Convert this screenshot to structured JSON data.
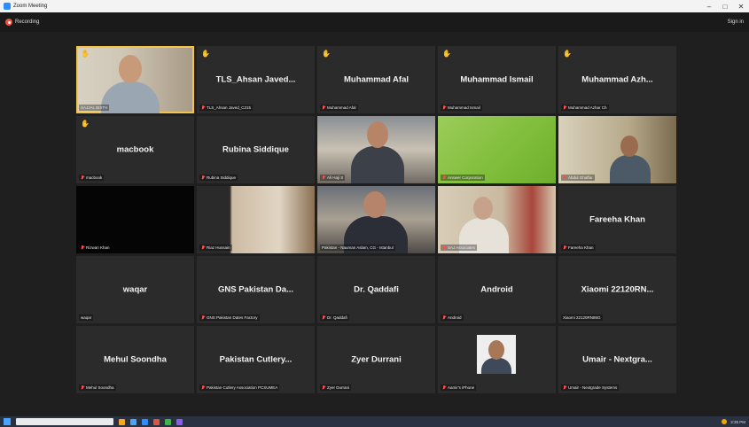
{
  "window": {
    "title": "Zoom Meeting",
    "minimize": "–",
    "maximize": "□",
    "close": "✕"
  },
  "topbar": {
    "recording_label": "Recording",
    "signin_label": "Sign in"
  },
  "tiles": [
    {
      "name": "",
      "label": "SAJJAL BISTH",
      "video": "cam-man",
      "highlight": true,
      "hand": true,
      "mic_off": false
    },
    {
      "name": "TLS_Ahsan Javed...",
      "label": "TLS_Ahsan Javed_C215",
      "hand": true,
      "mic_off": true
    },
    {
      "name": "Muhammad Afal",
      "label": "Muhammad Afal",
      "hand": true,
      "mic_off": true
    },
    {
      "name": "Muhammad Ismail",
      "label": "Muhammad Ismail",
      "hand": true,
      "mic_off": true
    },
    {
      "name": "Muhammad Azh...",
      "label": "Muhammad Azhar Ch",
      "hand": true,
      "mic_off": true
    },
    {
      "name": "macbook",
      "label": "macbook",
      "hand": true,
      "mic_off": true
    },
    {
      "name": "Rubina Siddique",
      "label": "Rubina Siddique",
      "hand": false,
      "mic_off": true
    },
    {
      "name": "",
      "label": "Ali Haji S",
      "video": "cam-office",
      "mic_off": true
    },
    {
      "name": "",
      "label": "Answer Corporation",
      "video": "cam-green",
      "mic_off": true
    },
    {
      "name": "",
      "label": "Abdul Ghaffar",
      "video": "cam-room",
      "mic_off": true
    },
    {
      "name": "",
      "label": "Rizwan Khan",
      "video": "cam-black",
      "mic_off": true
    },
    {
      "name": "",
      "label": "Riaz Hussain",
      "video": "cam-wall",
      "mic_off": true
    },
    {
      "name": "",
      "label": "Pakistan - Nauman Aslam, CG - Istanbul",
      "video": "cam-suit",
      "mic_off": false
    },
    {
      "name": "",
      "label": "SAJ Associates",
      "video": "cam-elder",
      "mic_off": true
    },
    {
      "name": "Fareeha Khan",
      "label": "Fareeha Khan",
      "mic_off": true
    },
    {
      "name": "waqar",
      "label": "waqar",
      "mic_off": false
    },
    {
      "name": "GNS Pakistan Da...",
      "label": "GNS Pakistan Dates Factory",
      "mic_off": true
    },
    {
      "name": "Dr. Qaddafi",
      "label": "Dr. Qaddafi",
      "mic_off": true
    },
    {
      "name": "Android",
      "label": "Android",
      "mic_off": true
    },
    {
      "name": "Xiaomi 22120RN...",
      "label": "Xiaomi 22120RN86G",
      "mic_off": false
    },
    {
      "name": "Mehul Soondha",
      "label": "Mehul Soondha",
      "mic_off": true
    },
    {
      "name": "Pakistan Cutlery...",
      "label": "Pakistan Cutlery Association PCSUMEA",
      "mic_off": true
    },
    {
      "name": "Zyer Durrani",
      "label": "Zyer Durrani",
      "mic_off": true
    },
    {
      "name": "",
      "label": "Aamir's iPhone",
      "video": "avatar",
      "mic_off": true
    },
    {
      "name": "Umair - Nextgra...",
      "label": "Umair - Nextgrade Systems",
      "mic_off": true
    }
  ],
  "taskbar": {
    "time": "3:35 PM"
  }
}
